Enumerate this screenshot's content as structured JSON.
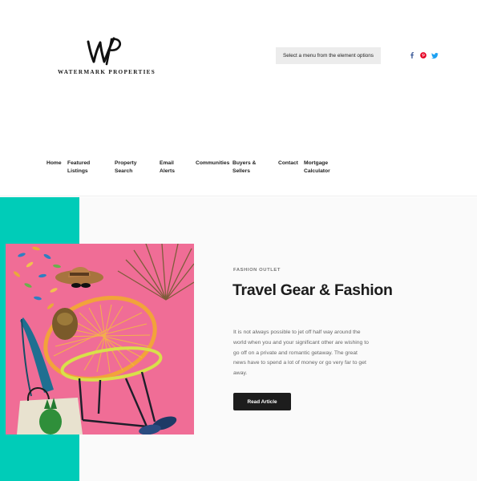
{
  "header": {
    "logo": {
      "monogram": "WP",
      "brand_name": "WATERMARK PROPERTIES"
    },
    "menu_select": {
      "label": "Select a menu from the element options"
    },
    "social": [
      {
        "icon": "facebook-icon",
        "color": "#3b5998"
      },
      {
        "icon": "pinterest-icon",
        "color": "#e60023"
      },
      {
        "icon": "twitter-icon",
        "color": "#1da1f2"
      }
    ]
  },
  "nav": {
    "items": [
      {
        "label": "Home"
      },
      {
        "label": "Featured Listings"
      },
      {
        "label": "Property Search"
      },
      {
        "label": "Email Alerts"
      },
      {
        "label": "Communities"
      },
      {
        "label": "Buyers & Sellers"
      },
      {
        "label": "Contact"
      },
      {
        "label": "Mortgage Calculator"
      }
    ]
  },
  "feature": {
    "eyebrow": "FASHION OUTLET",
    "title": "Travel Gear & Fashion",
    "body": "It is not always possible to jet off half way around the world when you and your significant other are wishing to go off on a private and romantic getaway. The great news have to spend a lot of money or go very far to get away.",
    "button_label": "Read Article"
  },
  "colors": {
    "accent_teal": "#00ccb8",
    "hero_pink": "#f06d96",
    "button_dark": "#1d1d1d"
  }
}
